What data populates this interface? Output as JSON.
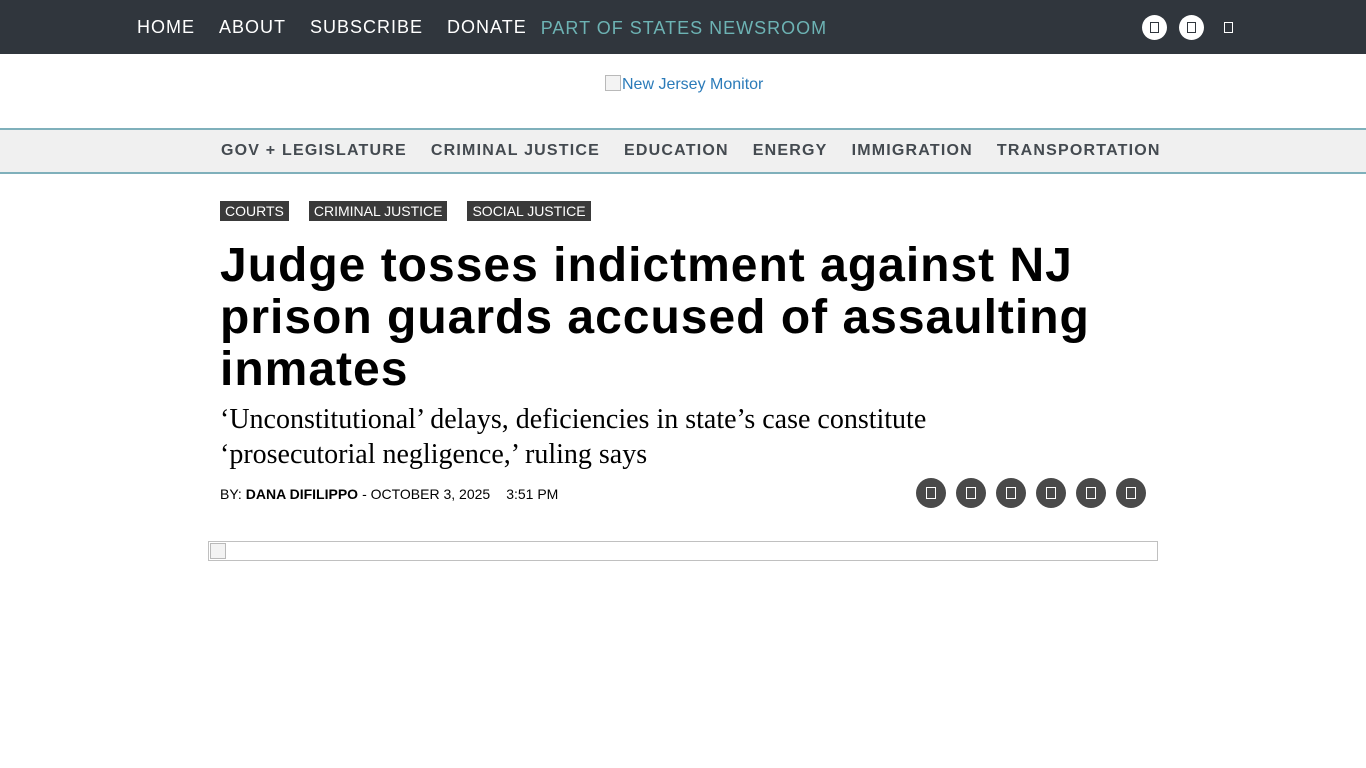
{
  "topbar": {
    "nav": [
      "HOME",
      "ABOUT",
      "SUBSCRIBE",
      "DONATE"
    ],
    "network": "PART OF STATES NEWSROOM",
    "social_icons": [
      "facebook-icon",
      "twitter-icon",
      "search-icon"
    ]
  },
  "logo": {
    "alt": "New Jersey Monitor"
  },
  "section_nav": [
    "GOV + LEGISLATURE",
    "CRIMINAL JUSTICE",
    "EDUCATION",
    "ENERGY",
    "IMMIGRATION",
    "TRANSPORTATION"
  ],
  "article": {
    "tags": [
      "COURTS",
      "CRIMINAL JUSTICE",
      "SOCIAL JUSTICE"
    ],
    "headline": "Judge tosses indictment against NJ prison guards accused of assaulting inmates",
    "subhead": "‘Unconstitutional’ delays, deficiencies in state’s case constitute ‘prosecutorial negligence,’ ruling says",
    "byline": {
      "prefix": "BY:",
      "author": "DANA DIFILIPPO",
      "date": "- OCTOBER 3, 2025",
      "time": "3:51 PM"
    },
    "share_icons": [
      "email-share-icon",
      "facebook-share-icon",
      "twitter-share-icon",
      "linkedin-share-icon",
      "print-share-icon",
      "republish-share-icon"
    ]
  },
  "colors": {
    "topbar_bg": "#30363d",
    "network_text": "#6db3b4",
    "section_nav_bg": "#f0f0f0",
    "section_nav_border": "#7fb0bb",
    "tag_bg": "#3a3a3a",
    "share_bg": "#4a4a4a"
  }
}
